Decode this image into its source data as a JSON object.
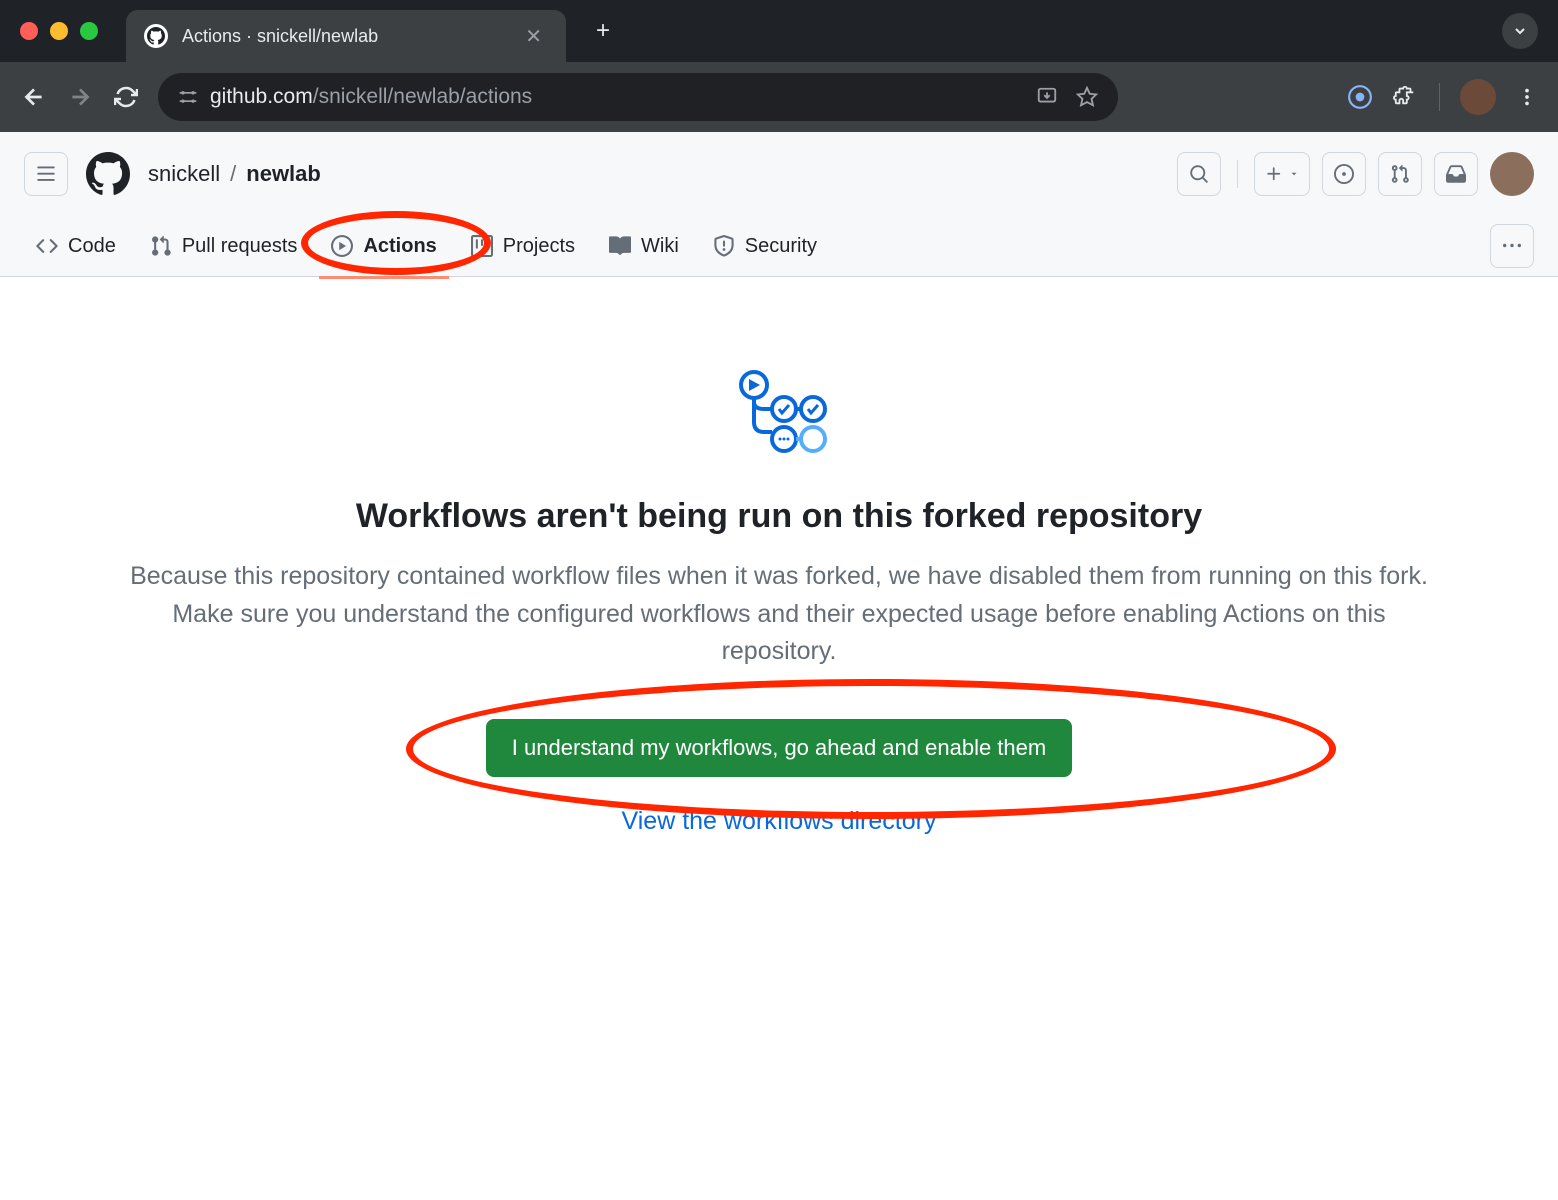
{
  "browser": {
    "tab_title": "Actions · snickell/newlab",
    "url_domain": "github.com",
    "url_path": "/snickell/newlab/actions"
  },
  "github": {
    "breadcrumb": {
      "owner": "snickell",
      "sep": "/",
      "repo": "newlab"
    },
    "tabs": {
      "code": "Code",
      "pull_requests": "Pull requests",
      "actions": "Actions",
      "projects": "Projects",
      "wiki": "Wiki",
      "security": "Security"
    }
  },
  "content": {
    "heading": "Workflows aren't being run on this forked repository",
    "description": "Because this repository contained workflow files when it was forked, we have disabled them from running on this fork. Make sure you understand the configured workflows and their expected usage before enabling Actions on this repository.",
    "enable_button": "I understand my workflows, go ahead and enable them",
    "view_link": "View the workflows directory"
  },
  "colors": {
    "annotation_red": "#ff2600",
    "primary_green": "#1f883d",
    "link_blue": "#0969da"
  }
}
